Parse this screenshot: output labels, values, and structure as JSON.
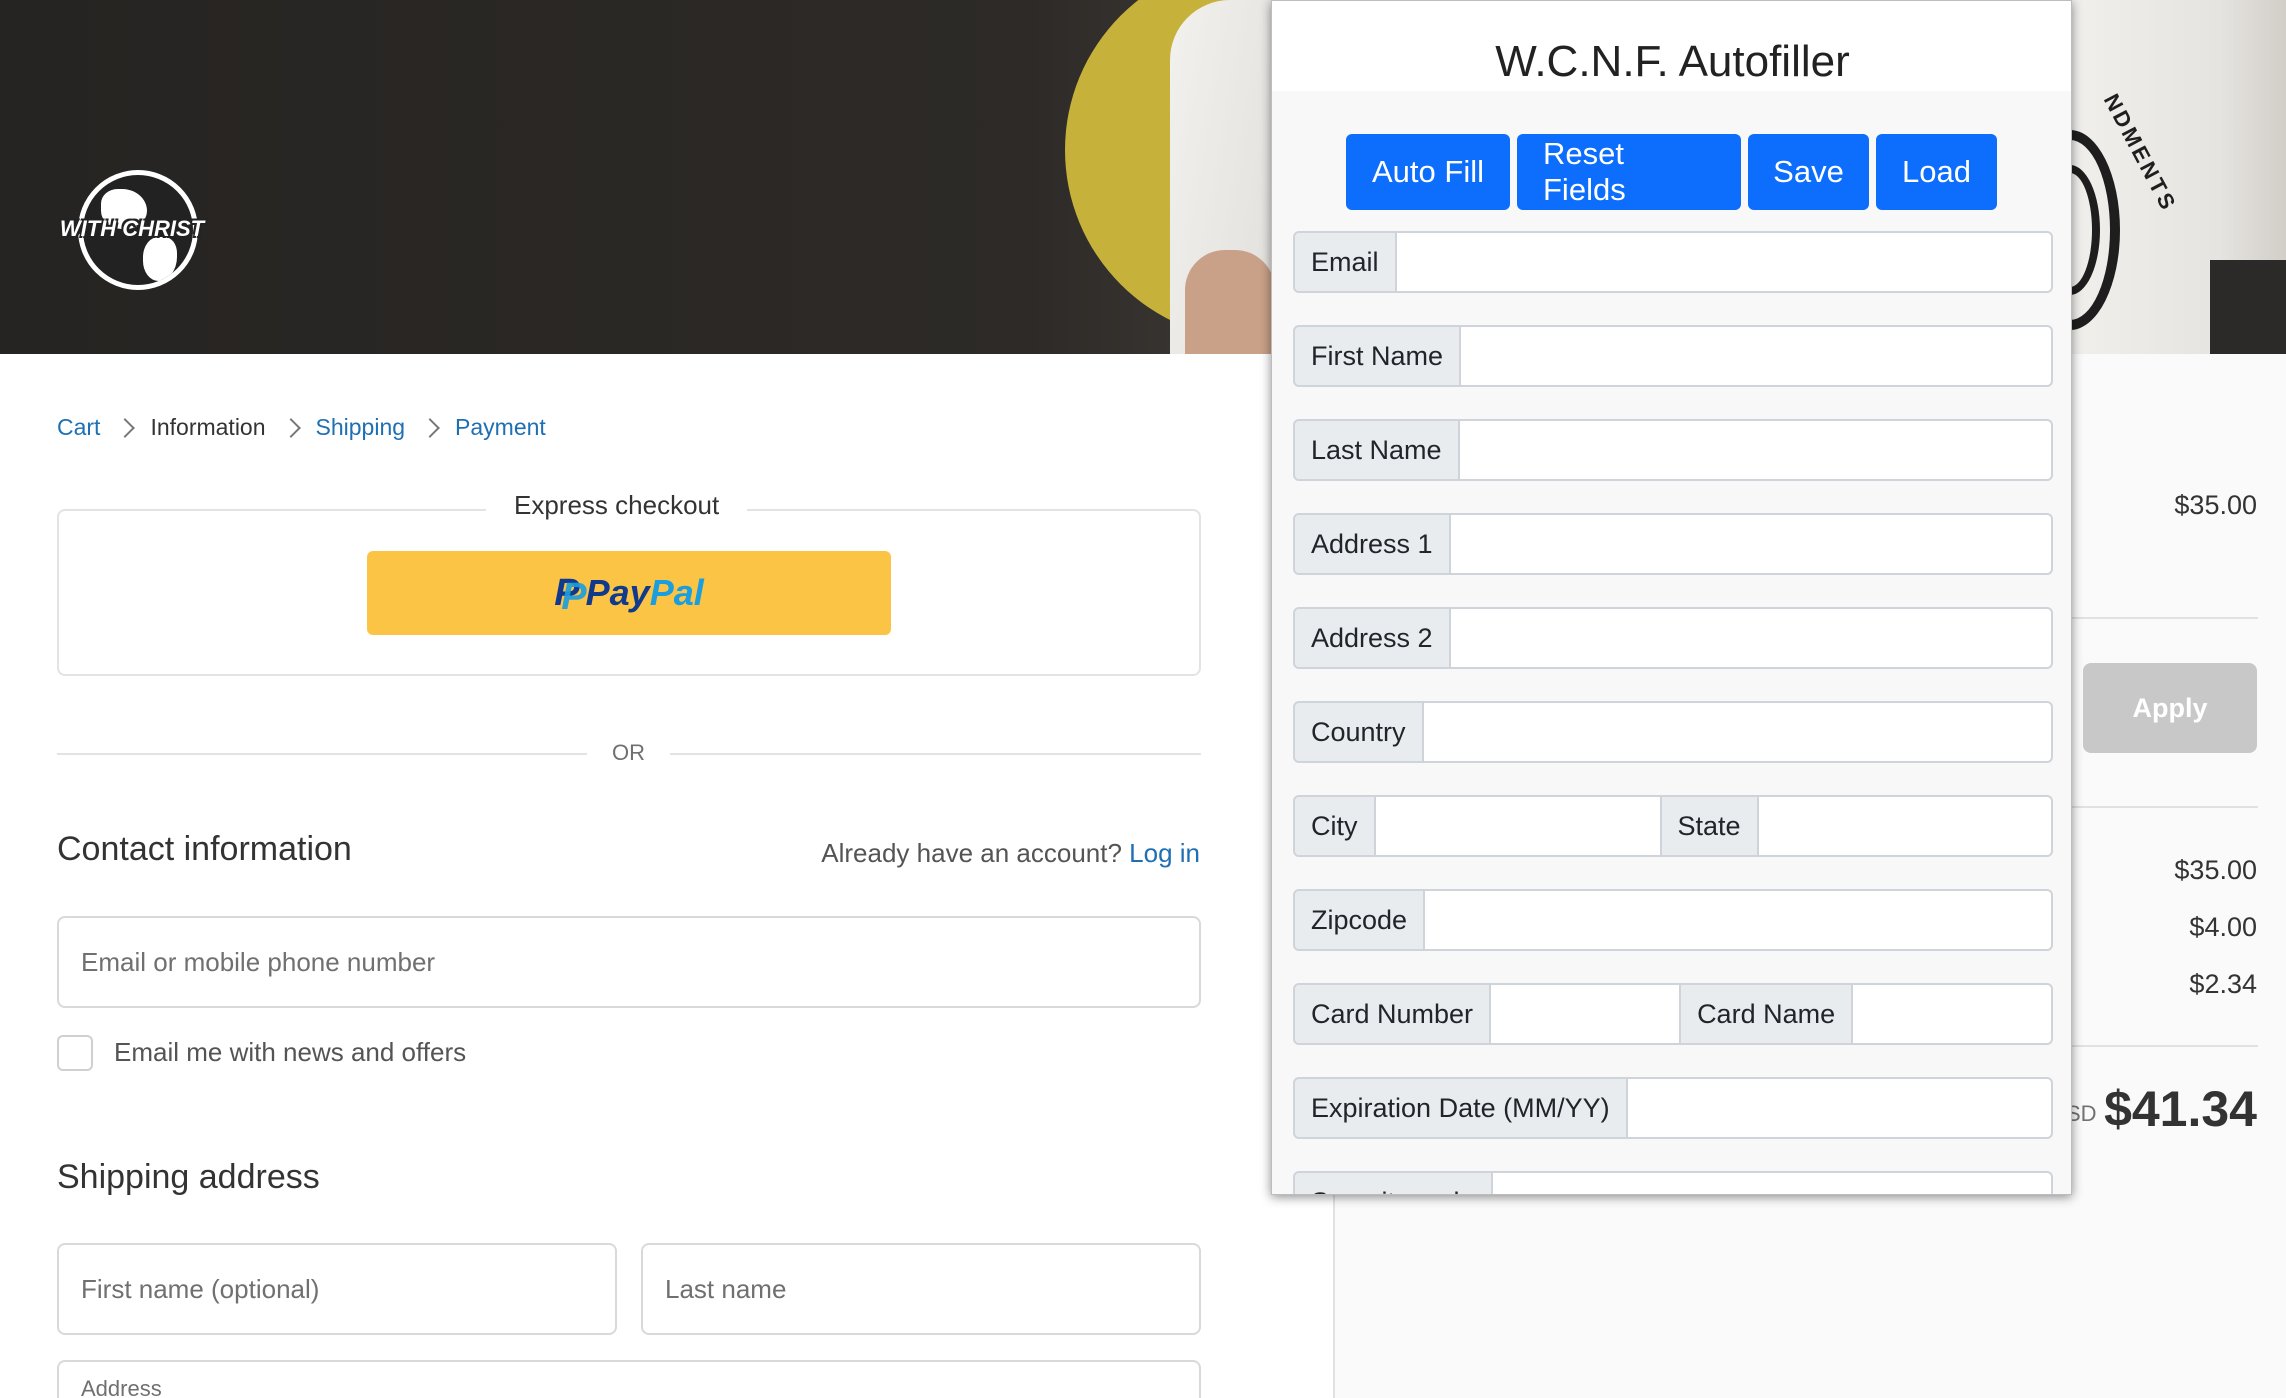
{
  "banner": {
    "logo_text": "WITH CHRIST",
    "shirt_text": "NDMENTS"
  },
  "breadcrumb": [
    {
      "label": "Cart"
    },
    {
      "label": "Information"
    },
    {
      "label": "Shipping"
    },
    {
      "label": "Payment"
    }
  ],
  "express": {
    "title": "Express checkout",
    "paypal_pay": "Pay",
    "paypal_pal": "Pal"
  },
  "divider_text": "OR",
  "contact": {
    "title": "Contact information",
    "account_prompt": "Already have an account?",
    "login_label": "Log in",
    "email_placeholder": "Email or mobile phone number",
    "newsletter_label": "Email me with news and offers"
  },
  "shipping": {
    "title": "Shipping address",
    "first_name_placeholder": "First name (optional)",
    "last_name_placeholder": "Last name",
    "address_label": "Address"
  },
  "summary": {
    "item_price": "$35.00",
    "apply_label": "Apply",
    "subtotal": "$35.00",
    "shipping": "$4.00",
    "taxes": "$2.34",
    "currency": "SD",
    "total": "$41.34"
  },
  "autofiller": {
    "title": "W.C.N.F. Autofiller",
    "buttons": {
      "auto_fill": "Auto Fill",
      "reset": "Reset Fields",
      "save": "Save",
      "load": "Load"
    },
    "fields": {
      "email": "Email",
      "first_name": "First Name",
      "last_name": "Last Name",
      "address1": "Address 1",
      "address2": "Address 2",
      "country": "Country",
      "city": "City",
      "state": "State",
      "zipcode": "Zipcode",
      "card_number": "Card Number",
      "card_name": "Card Name",
      "expiration": "Expiration Date (MM/YY)",
      "security_code": "Security code"
    }
  },
  "colors": {
    "link": "#1f6fb3",
    "paypal_yellow": "#fbc444",
    "primary_button": "#0d6efd",
    "apply_disabled": "#c8c8c8"
  }
}
